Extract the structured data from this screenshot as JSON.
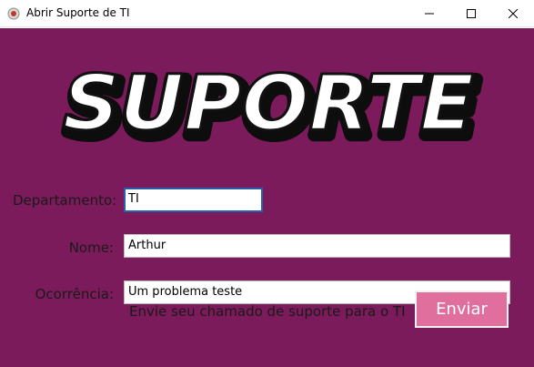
{
  "window": {
    "title": "Abrir Suporte de TI",
    "app_icon": "app-icon",
    "controls": {
      "minimize": "minimize-icon",
      "maximize": "maximize-icon",
      "close": "close-icon"
    }
  },
  "logo": {
    "text": "SUPORTE"
  },
  "form": {
    "departamento_label": "Departamento:",
    "departamento_value": "TI",
    "nome_label": "Nome:",
    "nome_value": "Arthur",
    "ocorrencia_label": "Ocorrência:",
    "ocorrencia_value": "Um problema teste"
  },
  "footer": {
    "hint_text": "Envie seu chamado de suporte para o TI",
    "send_label": "Enviar"
  },
  "colors": {
    "background": "#7b1b5b",
    "button": "#e06f9e",
    "focus_border": "#2a5ea8"
  }
}
